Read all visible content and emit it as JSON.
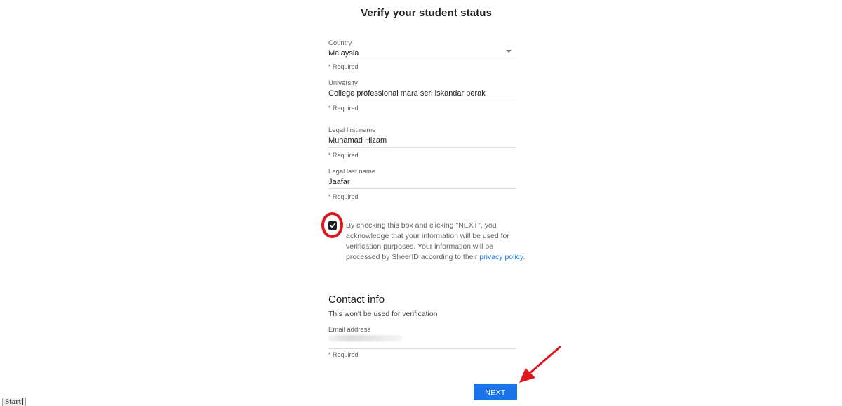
{
  "page": {
    "title": "Verify your student status"
  },
  "form": {
    "country": {
      "label": "Country",
      "value": "Malaysia",
      "required": "* Required"
    },
    "university": {
      "label": "University",
      "value": "College professional mara seri iskandar perak",
      "required": "* Required"
    },
    "first_name": {
      "label": "Legal first name",
      "value": "Muhamad Hizam",
      "required": "* Required"
    },
    "last_name": {
      "label": "Legal last name",
      "value": "Jaafar",
      "required": "* Required"
    },
    "consent": {
      "checked": true,
      "text": "By checking this box and clicking \"NEXT\", you acknowledge that your information will be used for verification purposes. Your information will be processed by SheerID according to their ",
      "link_text": "privacy policy",
      "text_end": "."
    }
  },
  "contact": {
    "heading": "Contact info",
    "subtitle": "This won't be used for verification",
    "email": {
      "label": "Email address",
      "value": "",
      "required": "* Required"
    }
  },
  "actions": {
    "next_label": "NEXT"
  },
  "taskbar": {
    "start_label": "Start"
  },
  "colors": {
    "accent": "#1a73e8",
    "annotation": "#e0161e"
  },
  "icons": {
    "dropdown": "caret-down-icon",
    "checkbox": "checkmark-icon",
    "annotation_arrow": "red-arrow-icon"
  }
}
